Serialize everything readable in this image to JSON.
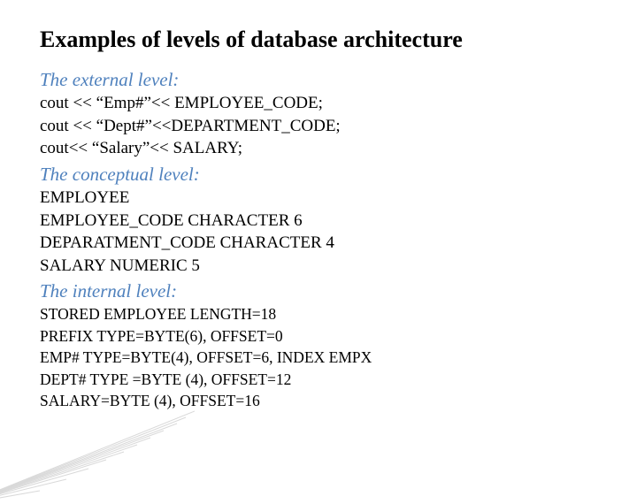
{
  "title": "Examples of levels of database architecture",
  "sections": {
    "external": {
      "heading": "The external level:",
      "lines": [
        "cout << “Emp#”<< EMPLOYEE_CODE;",
        "cout << “Dept#”<<DEPARTMENT_CODE;",
        "cout<< “Salary”<< SALARY;"
      ]
    },
    "conceptual": {
      "heading": "The conceptual level:",
      "lines": [
        "EMPLOYEE",
        "EMPLOYEE_CODE CHARACTER 6",
        "DEPARATMENT_CODE CHARACTER 4",
        "SALARY NUMERIC 5"
      ]
    },
    "internal": {
      "heading": "The internal level:",
      "lines": [
        "STORED EMPLOYEE LENGTH=18",
        "PREFIX TYPE=BYTE(6), OFFSET=0",
        "EMP# TYPE=BYTE(4), OFFSET=6, INDEX EMPX",
        "DEPT# TYPE =BYTE (4), OFFSET=12",
        "SALARY=BYTE (4), OFFSET=16"
      ]
    }
  }
}
